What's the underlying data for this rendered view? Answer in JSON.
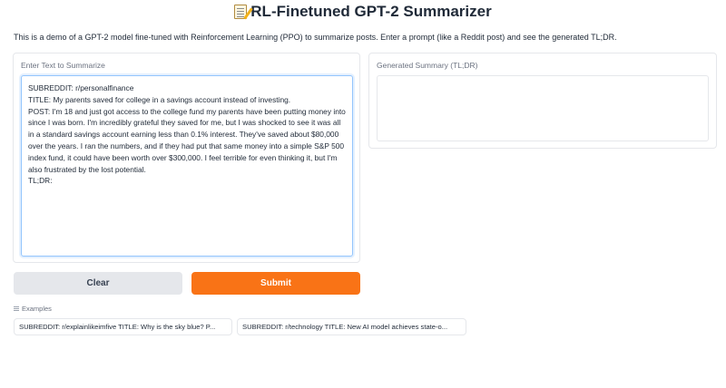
{
  "header": {
    "title": "RL-Finetuned GPT-2 Summarizer",
    "title_icon": "memo-icon",
    "description": "This is a demo of a GPT-2 model fine-tuned with Reinforcement Learning (PPO) to summarize posts. Enter a prompt (like a Reddit post) and see the generated TL;DR."
  },
  "input_panel": {
    "label": "Enter Text to Summarize",
    "value": "SUBREDDIT: r/personalfinance\nTITLE: My parents saved for college in a savings account instead of investing.\nPOST: I'm 18 and just got access to the college fund my parents have been putting money into since I was born. I'm incredibly grateful they saved for me, but I was shocked to see it was all in a standard savings account earning less than 0.1% interest. They've saved about $80,000 over the years. I ran the numbers, and if they had put that same money into a simple S&P 500 index fund, it could have been worth over $300,000. I feel terrible for even thinking it, but I'm also frustrated by the lost potential.\nTL;DR:"
  },
  "output_panel": {
    "label": "Generated Summary (TL;DR)",
    "value": ""
  },
  "buttons": {
    "clear_label": "Clear",
    "submit_label": "Submit"
  },
  "examples": {
    "label": "Examples",
    "items": [
      "SUBREDDIT: r/explainlikeimfive TITLE: Why is the sky blue? P...",
      "SUBREDDIT: r/technology TITLE: New AI model achieves state-o..."
    ]
  },
  "colors": {
    "accent": "#f97316",
    "secondary_button": "#e5e7eb",
    "focus_border": "#93c5fd"
  }
}
